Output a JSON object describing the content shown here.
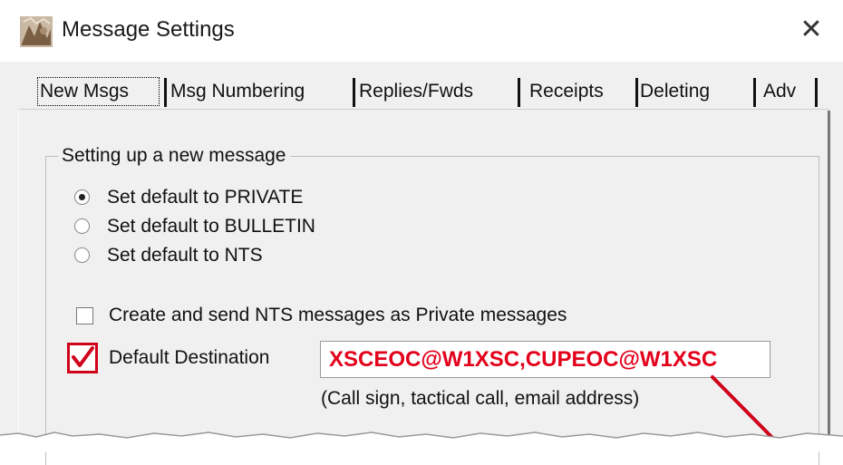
{
  "window": {
    "title": "Message Settings",
    "close_glyph": "✕"
  },
  "tabs": [
    {
      "label": "New Msgs",
      "active": true
    },
    {
      "label": "Msg Numbering",
      "active": false
    },
    {
      "label": "Replies/Fwds",
      "active": false
    },
    {
      "label": "Receipts",
      "active": false
    },
    {
      "label": "Deleting",
      "active": false
    },
    {
      "label": "Adv",
      "active": false
    }
  ],
  "group": {
    "legend": "Setting up a new message",
    "radios": [
      {
        "label": "Set default to PRIVATE",
        "selected": true
      },
      {
        "label": "Set default to BULLETIN",
        "selected": false
      },
      {
        "label": "Set default to NTS",
        "selected": false
      }
    ],
    "nts_private_checkbox": {
      "label": "Create and send NTS messages as Private messages",
      "checked": false
    },
    "default_destination": {
      "label": "Default Destination",
      "checked": true,
      "value": "XSCEOC@W1XSC,CUPEOC@W1XSC",
      "hint": "(Call sign, tactical call, email address)"
    }
  },
  "colors": {
    "annotation_red": "#d0021b",
    "value_red": "#e3001b",
    "dialog_bg": "#f0f0f0"
  },
  "icons": {
    "app": "app-icon",
    "close": "close-icon",
    "checkmark": "checkmark-icon"
  }
}
